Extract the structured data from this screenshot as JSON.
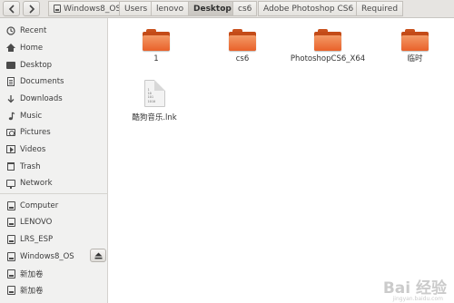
{
  "navigation": {
    "back_icon": "chevron-left-icon",
    "forward_icon": "chevron-right-icon"
  },
  "path": {
    "crumbs": [
      "Windows8_OS",
      "Users",
      "lenovo",
      "Desktop",
      "cs6",
      "Adobe Photoshop CS6",
      "Required"
    ],
    "active": "Desktop"
  },
  "sidebar": {
    "items": [
      {
        "label": "Recent",
        "icon": "clock-icon"
      },
      {
        "label": "Home",
        "icon": "home-icon"
      },
      {
        "label": "Desktop",
        "icon": "desktop-icon"
      },
      {
        "label": "Documents",
        "icon": "documents-icon"
      },
      {
        "label": "Downloads",
        "icon": "download-icon"
      },
      {
        "label": "Music",
        "icon": "music-icon"
      },
      {
        "label": "Pictures",
        "icon": "camera-icon"
      },
      {
        "label": "Videos",
        "icon": "video-icon"
      },
      {
        "label": "Trash",
        "icon": "trash-icon"
      },
      {
        "label": "Network",
        "icon": "network-icon"
      }
    ],
    "devices": [
      {
        "label": "Computer",
        "icon": "drive-icon"
      },
      {
        "label": "LENOVO",
        "icon": "drive-icon"
      },
      {
        "label": "LRS_ESP",
        "icon": "drive-icon"
      },
      {
        "label": "Windows8_OS",
        "icon": "drive-icon",
        "eject": true
      },
      {
        "label": "新加卷",
        "icon": "drive-icon"
      },
      {
        "label": "新加卷",
        "icon": "drive-icon"
      }
    ]
  },
  "files": [
    {
      "name": "1",
      "type": "folder"
    },
    {
      "name": "cs6",
      "type": "folder"
    },
    {
      "name": "PhotoshopCS6_X64",
      "type": "folder"
    },
    {
      "name": "临时",
      "type": "folder"
    },
    {
      "name": "酷狗音乐.lnk",
      "type": "binary"
    }
  ],
  "binary_icon_text": "1\n10\n101\n1010",
  "colors": {
    "folder_orange": "#e9612a",
    "sidebar_bg": "#f1f1f0",
    "pathbar_bg": "#e6e4e1"
  },
  "watermark": {
    "text": "Bai 经验",
    "sub": "jingyan.baidu.com"
  }
}
